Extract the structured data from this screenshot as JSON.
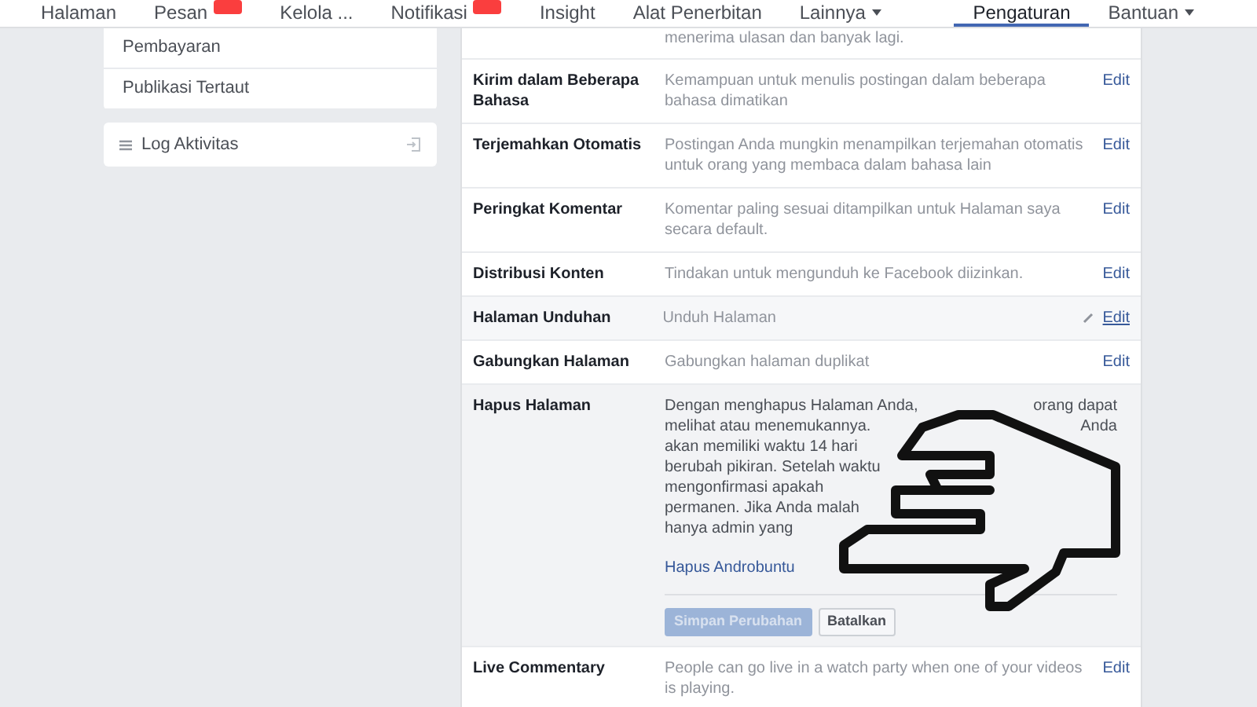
{
  "top_nav": {
    "items": [
      {
        "label": "Halaman",
        "selected": false,
        "badge": false,
        "caret": false
      },
      {
        "label": "Pesan",
        "selected": false,
        "badge": true,
        "caret": false
      },
      {
        "label": "Kelola ...",
        "selected": false,
        "badge": false,
        "caret": false
      },
      {
        "label": "Notifikasi",
        "selected": false,
        "badge": true,
        "caret": false
      },
      {
        "label": "Insight",
        "selected": false,
        "badge": false,
        "caret": false
      },
      {
        "label": "Alat Penerbitan",
        "selected": false,
        "badge": false,
        "caret": false
      },
      {
        "label": "Lainnya",
        "selected": false,
        "badge": false,
        "caret": true
      }
    ],
    "right_items": [
      {
        "label": "Pengaturan",
        "selected": true,
        "caret": false
      },
      {
        "label": "Bantuan",
        "selected": false,
        "caret": true
      }
    ]
  },
  "sidebar": {
    "items": [
      {
        "label": "Pembayaran",
        "kind": "sub"
      },
      {
        "label": "Publikasi Tertaut",
        "kind": "sub"
      },
      {
        "label": "Log Aktivitas",
        "kind": "card"
      }
    ]
  },
  "settings": {
    "top_text": "menerima ulasan dan banyak lagi.",
    "rows": [
      {
        "kind": "row",
        "label": "Kirim dalam Beberapa Bahasa",
        "description": "Kemampuan untuk menulis postingan dalam beberapa bahasa dimatikan",
        "edit": "Edit",
        "hovered": false
      },
      {
        "kind": "row",
        "label": "Terjemahkan Otomatis",
        "description": "Postingan Anda mungkin menampilkan terjemahan otomatis untuk orang yang membaca dalam bahasa lain",
        "edit": "Edit",
        "hovered": false
      },
      {
        "kind": "row",
        "label": "Peringkat Komentar",
        "description": "Komentar paling sesuai ditampilkan untuk Halaman saya secara default.",
        "edit": "Edit",
        "hovered": false
      },
      {
        "kind": "row",
        "label": "Distribusi Konten",
        "description": "Tindakan untuk mengunduh ke Facebook diizinkan.",
        "edit": "Edit",
        "hovered": false
      },
      {
        "kind": "row",
        "label": "Halaman Unduhan",
        "description": "Unduh Halaman",
        "edit": "Edit",
        "hovered": true
      },
      {
        "kind": "row",
        "label": "Gabungkan Halaman",
        "description": "Gabungkan halaman duplikat",
        "edit": "Edit",
        "hovered": false
      },
      {
        "kind": "expanded",
        "label": "Hapus Halaman",
        "lines": [
          [
            "Dengan menghapus Halaman Anda,",
            "orang dapat"
          ],
          [
            "melihat atau menemukannya.",
            "Anda"
          ],
          [
            "akan memiliki waktu 14 hari"
          ],
          [
            "berubah pikiran. Setelah waktu"
          ],
          [
            "mengonfirmasi apakah"
          ],
          [
            "permanen. Jika Anda malah"
          ],
          [
            "hanya admin yang"
          ]
        ],
        "link": "Hapus Androbuntu",
        "buttons": [
          {
            "label": "Simpan Perubahan",
            "disabled": true,
            "kind": "primary"
          },
          {
            "label": "Batalkan",
            "disabled": false,
            "kind": "secondary"
          }
        ]
      },
      {
        "kind": "row",
        "label": "Live Commentary",
        "description": "People can go live in a watch party when one of your videos is playing.",
        "edit": "Edit",
        "hovered": false
      }
    ]
  }
}
